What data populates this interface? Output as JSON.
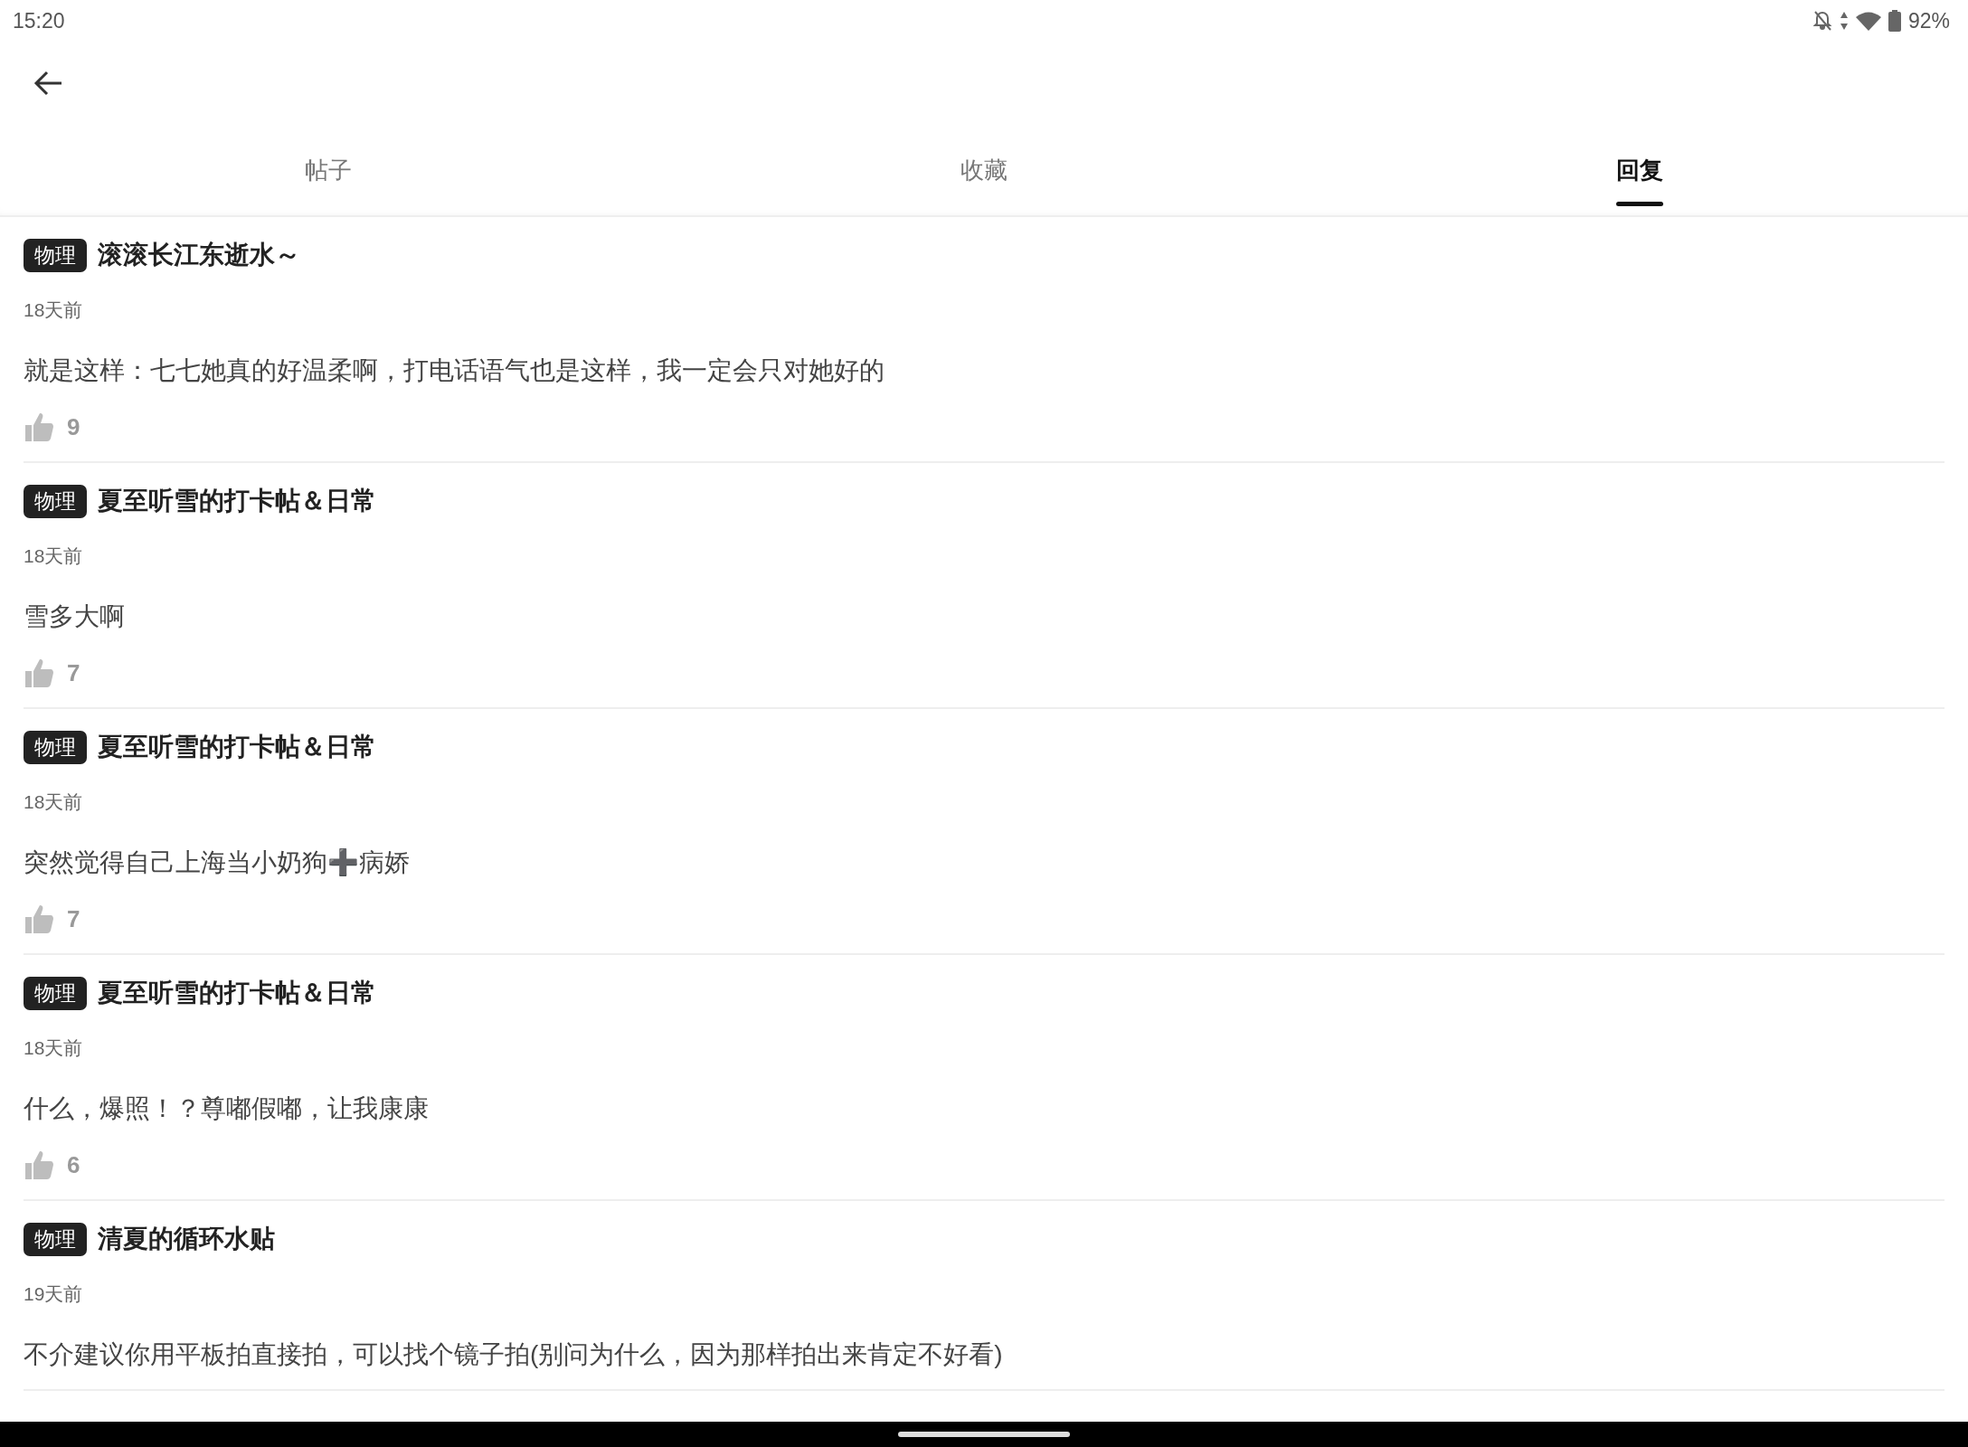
{
  "status_bar": {
    "time": "15:20",
    "battery": "92%"
  },
  "tabs": [
    {
      "label": "帖子",
      "selected": false
    },
    {
      "label": "收藏",
      "selected": false
    },
    {
      "label": "回复",
      "selected": true
    }
  ],
  "replies": [
    {
      "tag": "物理",
      "title": "滚滚长江东逝水～",
      "time": "18天前",
      "text": "就是这样：七七她真的好温柔啊，打电话语气也是这样，我一定会只对她好的",
      "likes": "9"
    },
    {
      "tag": "物理",
      "title": "夏至听雪的打卡帖＆日常",
      "time": "18天前",
      "text": "雪多大啊",
      "likes": "7"
    },
    {
      "tag": "物理",
      "title": "夏至听雪的打卡帖＆日常",
      "time": "18天前",
      "text": "突然觉得自己上海当小奶狗➕病娇",
      "likes": "7"
    },
    {
      "tag": "物理",
      "title": "夏至听雪的打卡帖＆日常",
      "time": "18天前",
      "text": "什么，爆照！？尊嘟假嘟，让我康康",
      "likes": "6"
    },
    {
      "tag": "物理",
      "title": "清夏的循环水贴",
      "time": "19天前",
      "text": "不介建议你用平板拍直接拍，可以找个镜子拍(别问为什么，因为那样拍出来肯定不好看)"
    }
  ]
}
